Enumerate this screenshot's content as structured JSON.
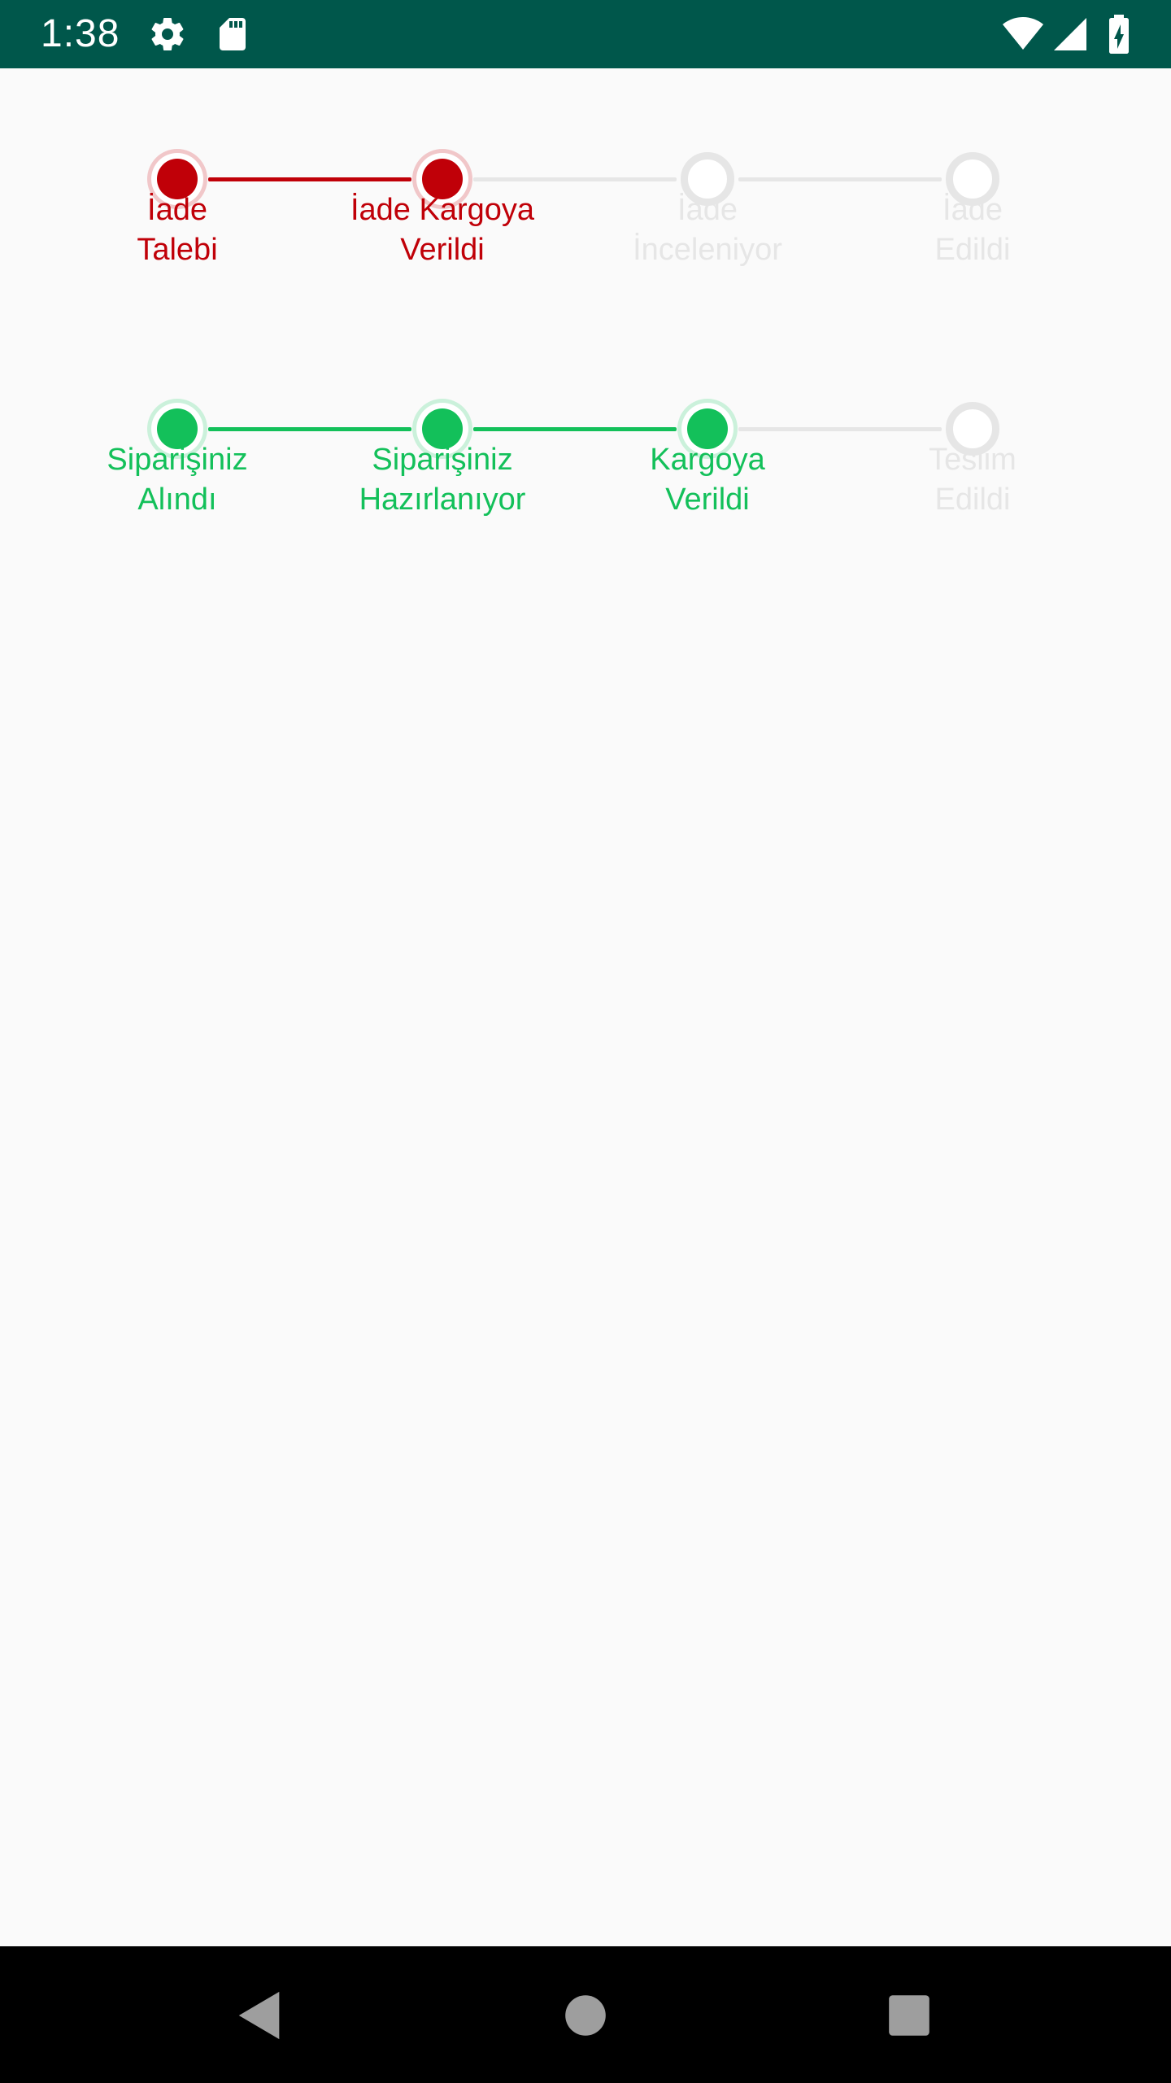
{
  "status_bar": {
    "time": "1:38",
    "icons": [
      "gear-icon",
      "sd-card-icon",
      "wifi-icon",
      "signal-icon",
      "battery-charging-icon"
    ],
    "background": "#00574b"
  },
  "return_steps": {
    "active_color": "#c00008",
    "inactive_color": "#e6e6e6",
    "active_count": 2,
    "steps": [
      {
        "line1": "İade",
        "line2": "Talebi",
        "active": true
      },
      {
        "line1": "İade Kargoya",
        "line2": "Verildi",
        "active": true
      },
      {
        "line1": "İade",
        "line2": "İnceleniyor",
        "active": false
      },
      {
        "line1": "İade",
        "line2": "Edildi",
        "active": false
      }
    ]
  },
  "order_steps": {
    "active_color": "#13c05a",
    "inactive_color": "#e6e6e6",
    "active_count": 3,
    "steps": [
      {
        "line1": "Siparişiniz",
        "line2": "Alındı",
        "active": true
      },
      {
        "line1": "Siparişiniz",
        "line2": "Hazırlanıyor",
        "active": true
      },
      {
        "line1": "Kargoya",
        "line2": "Verildi",
        "active": true
      },
      {
        "line1": "Teslim",
        "line2": "Edildi",
        "active": false
      }
    ]
  },
  "nav_bar": {
    "buttons": [
      "back-icon",
      "home-icon",
      "recents-icon"
    ]
  }
}
